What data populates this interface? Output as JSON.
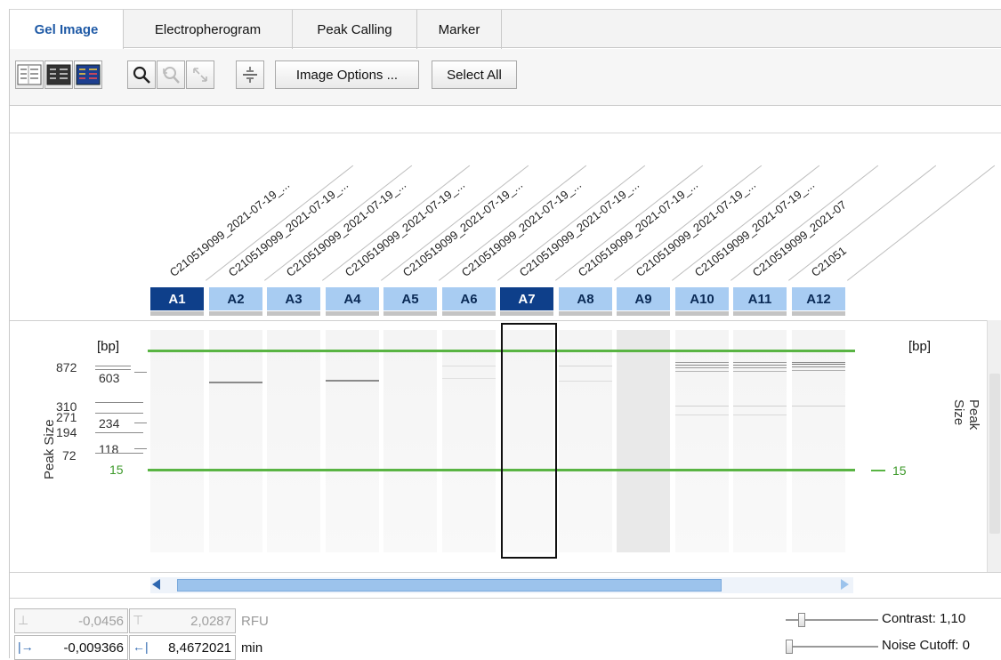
{
  "tabs": [
    {
      "label": "Gel Image",
      "active": true
    },
    {
      "label": "Electropherogram",
      "active": false
    },
    {
      "label": "Peak Calling",
      "active": false
    },
    {
      "label": "Marker",
      "active": false
    }
  ],
  "toolbar": {
    "image_options_label": "Image Options ...",
    "select_all_label": "Select All",
    "icons": [
      "gel-view-light-icon",
      "gel-view-dark-icon",
      "gel-view-blue-icon",
      "zoom-icon",
      "reset-zoom-icon",
      "fit-icon",
      "split-icon"
    ]
  },
  "samples": [
    {
      "well": "A1",
      "name": "C210519099_2021-07-19_...",
      "selected": true
    },
    {
      "well": "A2",
      "name": "C210519099_2021-07-19_...",
      "selected": false
    },
    {
      "well": "A3",
      "name": "C210519099_2021-07-19_...",
      "selected": false
    },
    {
      "well": "A4",
      "name": "C210519099_2021-07-19_...",
      "selected": false
    },
    {
      "well": "A5",
      "name": "C210519099_2021-07-19_...",
      "selected": false
    },
    {
      "well": "A6",
      "name": "C210519099_2021-07-19_...",
      "selected": false
    },
    {
      "well": "A7",
      "name": "C210519099_2021-07-19_...",
      "selected": true
    },
    {
      "well": "A8",
      "name": "C210519099_2021-07-19_...",
      "selected": false
    },
    {
      "well": "A9",
      "name": "C210519099_2021-07-19_...",
      "selected": false
    },
    {
      "well": "A10",
      "name": "C210519099_2021-07-19_...",
      "selected": false
    },
    {
      "well": "A11",
      "name": "C210519099_2021-07",
      "selected": false
    },
    {
      "well": "A12",
      "name": "C21051",
      "selected": false
    }
  ],
  "gel": {
    "unit_left": "[bp]",
    "unit_right": "[bp]",
    "axis_label_left": "Peak Size",
    "axis_label_right": "Peak Size",
    "ladder_left_col1": [
      "872",
      "310",
      "271",
      "194",
      "72"
    ],
    "ladder_left_col2": [
      "603",
      "234",
      "118"
    ],
    "marker_left": "15",
    "marker_right": "15",
    "marker_color": "#59b443",
    "selected_lane": "A7"
  },
  "readouts": {
    "rfu_low": "-0,0456",
    "rfu_high": "2,0287",
    "rfu_unit": "RFU",
    "time_start": "-0,009366",
    "time_end": "8,4672021",
    "time_unit": "min"
  },
  "sliders": {
    "contrast_label": "Contrast: 1,10",
    "noise_label": "Noise Cutoff: 0"
  }
}
